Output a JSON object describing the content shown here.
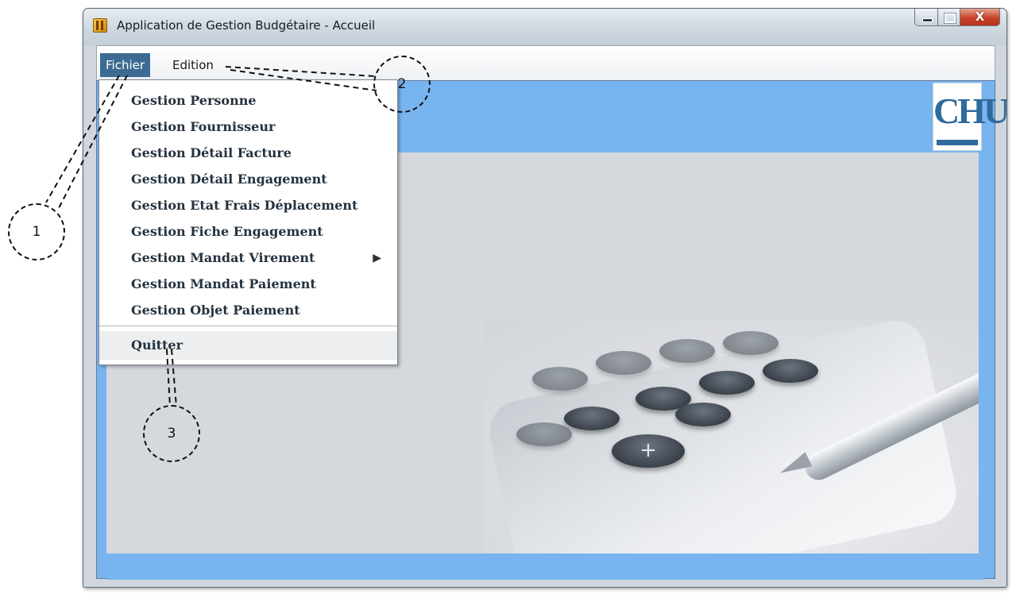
{
  "window": {
    "title": "Application de Gestion Budgétaire - Accueil",
    "icon": "app-icon",
    "buttons": {
      "minimize": "minimize-icon",
      "maximize": "maximize-icon",
      "close_label": "X"
    }
  },
  "menubar": {
    "items": [
      {
        "label": "Fichier",
        "active": true
      },
      {
        "label": "Edition",
        "active": false
      }
    ]
  },
  "dropdown": {
    "items": [
      {
        "label": "Gestion Personne"
      },
      {
        "label": "Gestion Fournisseur"
      },
      {
        "label": "Gestion Détail Facture"
      },
      {
        "label": "Gestion Détail Engagement"
      },
      {
        "label": "Gestion Etat Frais Déplacement"
      },
      {
        "label": "Gestion Fiche Engagement"
      },
      {
        "label": "Gestion Mandat Virement",
        "submenu_arrow": "▶"
      },
      {
        "label": "Gestion Mandat Paiement"
      },
      {
        "label": "Gestion Objet Paiement"
      }
    ],
    "quit": {
      "label": "Quitter"
    }
  },
  "logo": {
    "text": "CHU"
  },
  "annotations": {
    "callout1": "1",
    "callout2": "2",
    "callout3": "3"
  },
  "colors": {
    "content_bg": "#78b4f0",
    "menu_active": "#3c6a92",
    "panel": "#d5d8dd"
  }
}
